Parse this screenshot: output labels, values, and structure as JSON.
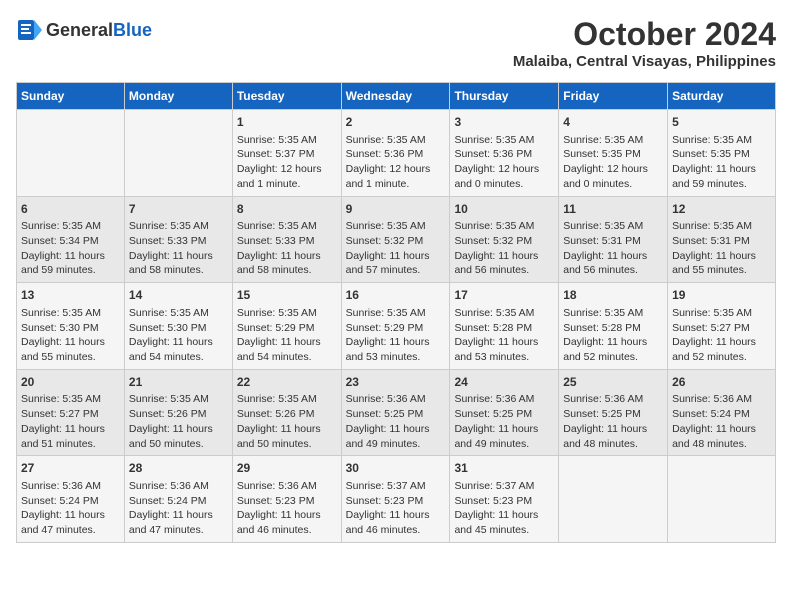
{
  "logo": {
    "general": "General",
    "blue": "Blue"
  },
  "title": {
    "month": "October 2024",
    "location": "Malaiba, Central Visayas, Philippines"
  },
  "headers": [
    "Sunday",
    "Monday",
    "Tuesday",
    "Wednesday",
    "Thursday",
    "Friday",
    "Saturday"
  ],
  "weeks": [
    {
      "days": [
        {
          "date": "",
          "content": ""
        },
        {
          "date": "",
          "content": ""
        },
        {
          "date": "1",
          "content": "Sunrise: 5:35 AM\nSunset: 5:37 PM\nDaylight: 12 hours\nand 1 minute."
        },
        {
          "date": "2",
          "content": "Sunrise: 5:35 AM\nSunset: 5:36 PM\nDaylight: 12 hours\nand 1 minute."
        },
        {
          "date": "3",
          "content": "Sunrise: 5:35 AM\nSunset: 5:36 PM\nDaylight: 12 hours\nand 0 minutes."
        },
        {
          "date": "4",
          "content": "Sunrise: 5:35 AM\nSunset: 5:35 PM\nDaylight: 12 hours\nand 0 minutes."
        },
        {
          "date": "5",
          "content": "Sunrise: 5:35 AM\nSunset: 5:35 PM\nDaylight: 11 hours\nand 59 minutes."
        }
      ]
    },
    {
      "days": [
        {
          "date": "6",
          "content": "Sunrise: 5:35 AM\nSunset: 5:34 PM\nDaylight: 11 hours\nand 59 minutes."
        },
        {
          "date": "7",
          "content": "Sunrise: 5:35 AM\nSunset: 5:33 PM\nDaylight: 11 hours\nand 58 minutes."
        },
        {
          "date": "8",
          "content": "Sunrise: 5:35 AM\nSunset: 5:33 PM\nDaylight: 11 hours\nand 58 minutes."
        },
        {
          "date": "9",
          "content": "Sunrise: 5:35 AM\nSunset: 5:32 PM\nDaylight: 11 hours\nand 57 minutes."
        },
        {
          "date": "10",
          "content": "Sunrise: 5:35 AM\nSunset: 5:32 PM\nDaylight: 11 hours\nand 56 minutes."
        },
        {
          "date": "11",
          "content": "Sunrise: 5:35 AM\nSunset: 5:31 PM\nDaylight: 11 hours\nand 56 minutes."
        },
        {
          "date": "12",
          "content": "Sunrise: 5:35 AM\nSunset: 5:31 PM\nDaylight: 11 hours\nand 55 minutes."
        }
      ]
    },
    {
      "days": [
        {
          "date": "13",
          "content": "Sunrise: 5:35 AM\nSunset: 5:30 PM\nDaylight: 11 hours\nand 55 minutes."
        },
        {
          "date": "14",
          "content": "Sunrise: 5:35 AM\nSunset: 5:30 PM\nDaylight: 11 hours\nand 54 minutes."
        },
        {
          "date": "15",
          "content": "Sunrise: 5:35 AM\nSunset: 5:29 PM\nDaylight: 11 hours\nand 54 minutes."
        },
        {
          "date": "16",
          "content": "Sunrise: 5:35 AM\nSunset: 5:29 PM\nDaylight: 11 hours\nand 53 minutes."
        },
        {
          "date": "17",
          "content": "Sunrise: 5:35 AM\nSunset: 5:28 PM\nDaylight: 11 hours\nand 53 minutes."
        },
        {
          "date": "18",
          "content": "Sunrise: 5:35 AM\nSunset: 5:28 PM\nDaylight: 11 hours\nand 52 minutes."
        },
        {
          "date": "19",
          "content": "Sunrise: 5:35 AM\nSunset: 5:27 PM\nDaylight: 11 hours\nand 52 minutes."
        }
      ]
    },
    {
      "days": [
        {
          "date": "20",
          "content": "Sunrise: 5:35 AM\nSunset: 5:27 PM\nDaylight: 11 hours\nand 51 minutes."
        },
        {
          "date": "21",
          "content": "Sunrise: 5:35 AM\nSunset: 5:26 PM\nDaylight: 11 hours\nand 50 minutes."
        },
        {
          "date": "22",
          "content": "Sunrise: 5:35 AM\nSunset: 5:26 PM\nDaylight: 11 hours\nand 50 minutes."
        },
        {
          "date": "23",
          "content": "Sunrise: 5:36 AM\nSunset: 5:25 PM\nDaylight: 11 hours\nand 49 minutes."
        },
        {
          "date": "24",
          "content": "Sunrise: 5:36 AM\nSunset: 5:25 PM\nDaylight: 11 hours\nand 49 minutes."
        },
        {
          "date": "25",
          "content": "Sunrise: 5:36 AM\nSunset: 5:25 PM\nDaylight: 11 hours\nand 48 minutes."
        },
        {
          "date": "26",
          "content": "Sunrise: 5:36 AM\nSunset: 5:24 PM\nDaylight: 11 hours\nand 48 minutes."
        }
      ]
    },
    {
      "days": [
        {
          "date": "27",
          "content": "Sunrise: 5:36 AM\nSunset: 5:24 PM\nDaylight: 11 hours\nand 47 minutes."
        },
        {
          "date": "28",
          "content": "Sunrise: 5:36 AM\nSunset: 5:24 PM\nDaylight: 11 hours\nand 47 minutes."
        },
        {
          "date": "29",
          "content": "Sunrise: 5:36 AM\nSunset: 5:23 PM\nDaylight: 11 hours\nand 46 minutes."
        },
        {
          "date": "30",
          "content": "Sunrise: 5:37 AM\nSunset: 5:23 PM\nDaylight: 11 hours\nand 46 minutes."
        },
        {
          "date": "31",
          "content": "Sunrise: 5:37 AM\nSunset: 5:23 PM\nDaylight: 11 hours\nand 45 minutes."
        },
        {
          "date": "",
          "content": ""
        },
        {
          "date": "",
          "content": ""
        }
      ]
    }
  ]
}
